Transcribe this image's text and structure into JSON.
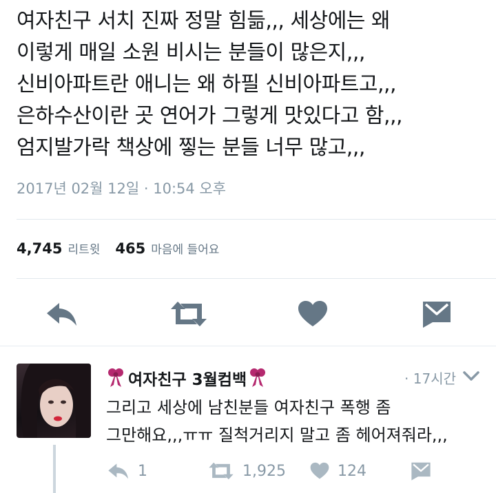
{
  "tweet": {
    "lines": [
      "여자친구 서치 진짜 정말 힘듦,,, 세상에는 왜",
      "이렇게 매일 소원 비시는 분들이 많은지,,,",
      "신비아파트란 애니는 왜 하필 신비아파트고,,,",
      "은하수산이란 곳 연어가 그렇게 맛있다고 함,,,",
      "엄지발가락 책상에 찧는 분들 너무 많고,,,"
    ],
    "timestamp": "2017년 02월 12일 · 10:54 오후"
  },
  "stats": {
    "retweets_count": "4,745",
    "retweets_label": "리트윗",
    "likes_count": "465",
    "likes_label": "마음에 들어요"
  },
  "actions": {
    "icons": [
      "reply-icon",
      "retweet-icon",
      "heart-icon",
      "message-icon"
    ],
    "color": "#657786"
  },
  "reply": {
    "name": "여자친구 3월컴백",
    "time": "· 17시간",
    "lines": [
      "그리고 세상에 남친분들 여자친구 폭행 좀",
      "그만해요,,,ㅠㅠ 질척거리지 말고 좀 헤어져줘라,,,"
    ],
    "reply_count": "1",
    "retweet_count": "1,925",
    "like_count": "124",
    "ribbon_color": "#b5296f",
    "icon_color": "#aab8c2"
  }
}
